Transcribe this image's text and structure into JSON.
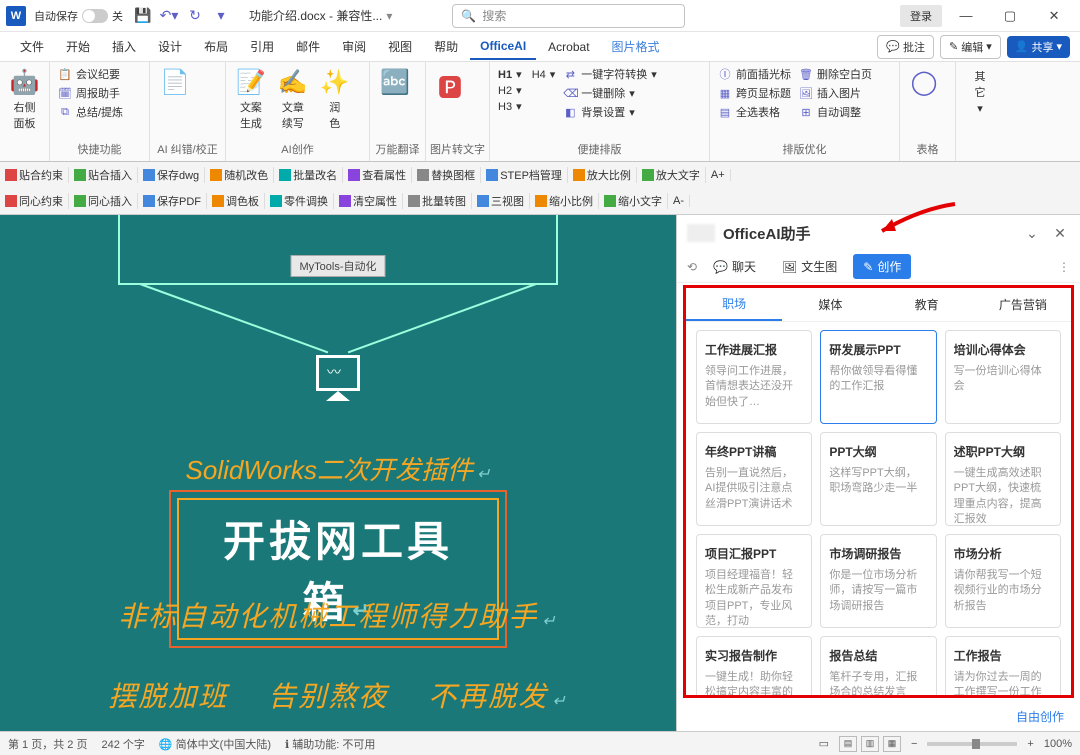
{
  "titlebar": {
    "autosave_label": "自动保存",
    "autosave_state": "关",
    "doc_title": "功能介绍.docx - 兼容性...",
    "search_placeholder": "搜索",
    "login": "登录"
  },
  "ribbon_tabs": [
    "文件",
    "开始",
    "插入",
    "设计",
    "布局",
    "引用",
    "邮件",
    "审阅",
    "视图",
    "帮助",
    "OfficeAI",
    "Acrobat",
    "图片格式"
  ],
  "ribbon_tabs_active": "OfficeAI",
  "ribbon_right": {
    "comments": "批注",
    "edit": "编辑",
    "share": "共享"
  },
  "ribbon": {
    "panel": {
      "label": "右侧\n面板"
    },
    "quick": {
      "items": [
        "会议纪要",
        "周报助手",
        "总结/提炼"
      ],
      "label": "快捷功能"
    },
    "proof": {
      "btn": "",
      "label": "AI 纠错/校正"
    },
    "create": {
      "btn1": "文案\n生成",
      "btn2": "文章\n续写",
      "btn3": "润\n色",
      "label": "AI创作"
    },
    "translate": {
      "label": "万能翻译"
    },
    "img2text": {
      "label": "图片转文字"
    },
    "typeset": {
      "h1": "H1",
      "h4": "H4",
      "h2": "H2",
      "h3": "H3",
      "items": [
        "一键字符转换",
        "一键删除",
        "背景设置"
      ],
      "label": "便捷排版"
    },
    "optimize": {
      "items": [
        "前面插光标",
        "跨页显标题",
        "全选表格",
        "删除空白页",
        "插入图片",
        "自动调整"
      ],
      "label": "排版优化"
    },
    "tables": {
      "label": "表格"
    },
    "other": {
      "btn": "其\n它"
    }
  },
  "plugin_rows": [
    [
      "贴合约束",
      "贴合插入",
      "保存dwg",
      "随机改色",
      "批量改名",
      "查看属性",
      "替换图框",
      "STEP档管理",
      "放大比例",
      "放大文字"
    ],
    [
      "同心约束",
      "同心插入",
      "保存PDF",
      "调色板",
      "零件调换",
      "清空属性",
      "批量转图",
      "三视图",
      "缩小比例",
      "缩小文字"
    ]
  ],
  "tooltip": "MyTools-自动化",
  "document": {
    "sw_line": "SolidWorks二次开发插件",
    "big_title": "开拔网工具箱",
    "line1": "非标自动化机械工程师得力助手",
    "line2": [
      "摆脱加班",
      "告别熬夜",
      "不再脱发"
    ]
  },
  "sidepane": {
    "title": "OfficeAI助手",
    "tabs": [
      {
        "icon": "💬",
        "label": "聊天"
      },
      {
        "icon": "🖼",
        "label": "文生图"
      },
      {
        "icon": "✎",
        "label": "创作"
      }
    ],
    "tabs_active": 2,
    "categories": [
      "职场",
      "媒体",
      "教育",
      "广告营销"
    ],
    "cat_active": 0,
    "cards": [
      {
        "title": "工作进展汇报",
        "desc": "领导问工作进展，首情想表达还没开始但快了…"
      },
      {
        "title": "研发展示PPT",
        "desc": "帮你做领导看得懂的工作汇报",
        "hilite": true
      },
      {
        "title": "培训心得体会",
        "desc": "写一份培训心得体会"
      },
      {
        "title": "年终PPT讲稿",
        "desc": "告别一直说然后，AI提供吸引注意点丝滑PPT演讲话术"
      },
      {
        "title": "PPT大纲",
        "desc": "这样写PPT大纲，职场弯路少走一半"
      },
      {
        "title": "述职PPT大纲",
        "desc": "一键生成高效述职PPT大纲，快速梳理重点内容，提高汇报效"
      },
      {
        "title": "项目汇报PPT",
        "desc": "项目经理福音！轻松生成新产品发布项目PPT，专业风范，打动"
      },
      {
        "title": "市场调研报告",
        "desc": "你是一位市场分析师，请按写一篇市场调研报告"
      },
      {
        "title": "市场分析",
        "desc": "请你帮我写一个短视频行业的市场分析报告"
      },
      {
        "title": "实习报告制作",
        "desc": "一键生成！助你轻松搞定内容丰富的实习报告，提升实习"
      },
      {
        "title": "报告总结",
        "desc": "笔杆子专用，汇报场合的总结发言"
      },
      {
        "title": "工作报告",
        "desc": "请为你过去一周的工作撰写一份工作报告"
      }
    ],
    "free_create": "自由创作"
  },
  "statusbar": {
    "page": "第 1 页，共 2 页",
    "words": "242 个字",
    "lang": "简体中文(中国大陆)",
    "access": "辅助功能: 不可用",
    "zoom": "100%"
  }
}
